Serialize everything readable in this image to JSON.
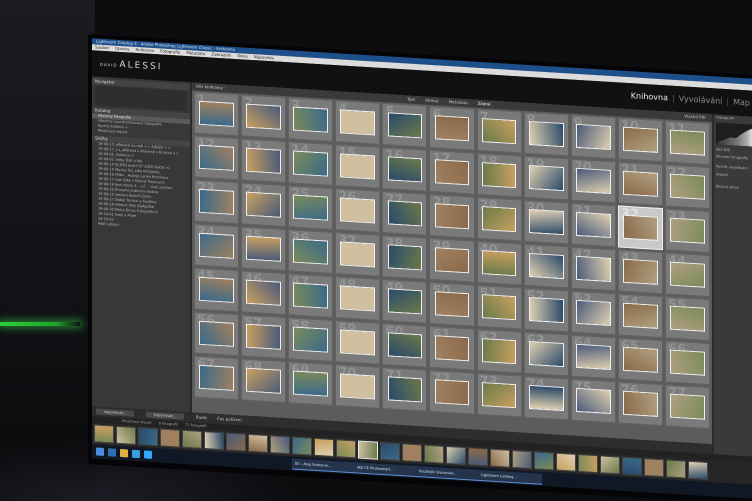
{
  "window": {
    "title": "Lightroom Catalog 4 - Adobe Photoshop Lightroom Classic - Knihovna"
  },
  "menu": [
    "Soubor",
    "Úpravy",
    "Knihovna",
    "Fotografie",
    "Metadata",
    "Zobrazení",
    "Okno",
    "Nápověda"
  ],
  "identity": {
    "first": "DAVID",
    "last": "ALESSI"
  },
  "modules": {
    "active": "Knihovna",
    "next": "Vyvolávání",
    "more": "Map"
  },
  "left_panel": {
    "navigator": "Navigátor",
    "catalog": "Katalog",
    "catalog_items": [
      "Všechny fotografie",
      "Všechny synchronizované fotografie",
      "Rychlá kolekce +",
      "Předchozí import"
    ],
    "folders": "Složky",
    "folder_items": [
      "19-08-15_aflétová na rodi + c Alžběti + c",
      "19-08-17_s:t_aflétová v Ahoroně s Erutrou a c",
      "18-09-01_ilustnice 5",
      "19-09-01 volby Dalí a Ale",
      "19-09-14 VJ DYD dustil 07 2019 Sektor n.",
      "19-09-15 Mucha fes_elbe Kristýnka",
      "19-09-16 Hliko... Adorja Lenka Knerhaus",
      "19-09-17 Lion Bike s Kikinal Pizzousov",
      "19-09-19 bez mostu 4 – v.č. – moji zmaterí",
      "19-09-20 Kruseho Joskhoux Koikos",
      "19-09-25 sendva Rudolf Zikolu",
      "19-09-27 Ďábel Tecnixi a Soulboy",
      "19-09-28 Hřebečí Bílý Z&AjoOdr",
      "19-09-30 Mirka Brnos Fotografie.b",
      "19-10-01 Eseji a Pepe",
      "19-10-02",
      "RAW sobour"
    ],
    "import_btn": "Importovat...",
    "export_btn": "Exportovat..."
  },
  "grid": {
    "header": "Filtr knihovny :",
    "filters": [
      "Text",
      "Atribut",
      "Metadata",
      "Žádné"
    ],
    "active_filter": "Žádné",
    "sort": "Vlastní filtr",
    "selected": 32,
    "numbers": [
      1,
      2,
      3,
      4,
      5,
      6,
      7,
      8,
      9,
      10,
      11,
      12,
      13,
      14,
      15,
      16,
      17,
      18,
      19,
      20,
      21,
      22,
      23,
      24,
      25,
      26,
      27,
      28,
      29,
      30,
      31,
      32,
      33,
      34,
      35,
      36,
      37,
      38,
      39,
      40,
      41,
      42,
      43,
      44,
      45,
      46,
      47,
      48,
      49,
      50,
      51,
      52,
      53,
      54,
      55,
      56,
      57,
      58,
      59,
      60,
      61,
      62,
      63,
      64,
      65,
      66,
      67,
      68,
      69,
      70,
      71,
      72,
      73,
      74,
      75,
      76,
      77
    ],
    "thumb_colors": [
      "#3a6a8a",
      "#c8a060",
      "#7a8a5a",
      "#d0c0a0",
      "#2a4a6a",
      "#a08060",
      "#6a7a4a",
      "#e0d0b0",
      "#4a5a7a",
      "#8a6a4a",
      "#b0a080"
    ]
  },
  "toolbar": {
    "sort_label": "Řadit:",
    "sort_value": "Čas pořízení"
  },
  "filmstrip": {
    "source": "Předchozí import",
    "count": "6 fotografií",
    "total": "77 fotografií"
  },
  "right_panel": {
    "histogram": "Histogram",
    "quick_develop": "Rychlé vyvolávání",
    "saved_preset": "Vlastní",
    "stats": "ISO 400",
    "original_label": "Původní fotografie",
    "keywords": "Klíčová slova"
  },
  "taskbar": {
    "apps": [
      "05 – Ahoj Sobranie...",
      "ADI CE Photosmart...",
      "Pouštějící Úvozovka...",
      "Lightroom Catalog..."
    ]
  }
}
